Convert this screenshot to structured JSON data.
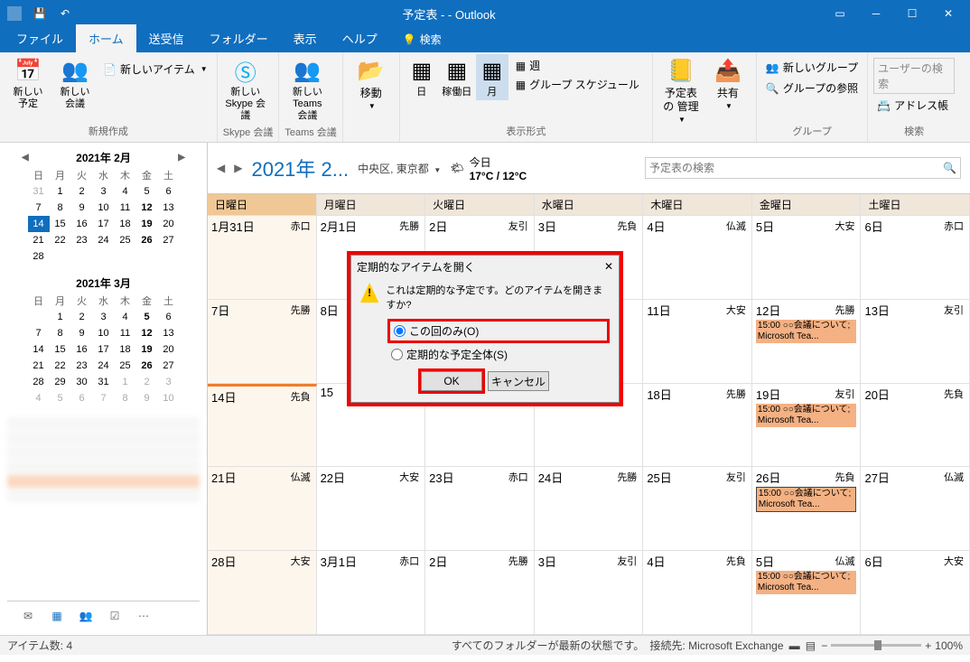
{
  "title": "予定表 -                      - Outlook",
  "tabs": {
    "file": "ファイル",
    "home": "ホーム",
    "send": "送受信",
    "folder": "フォルダー",
    "view": "表示",
    "help": "ヘルプ",
    "search": "検索"
  },
  "ribbon": {
    "newAppt": "新しい\n予定",
    "newMeeting": "新しい\n会議",
    "newItem": "新しいアイテム",
    "grpNew": "新規作成",
    "skype": "新しい\nSkype 会議",
    "grpSkype": "Skype 会議",
    "teams": "新しい\nTeams 会議",
    "grpTeams": "Teams 会議",
    "move": "移動",
    "day": "日",
    "workweek": "稼働日",
    "month": "月",
    "week": "週",
    "groupSched": "グループ スケジュール",
    "grpView": "表示形式",
    "manageCal": "予定表の\n管理",
    "share": "共有",
    "newGroup": "新しいグループ",
    "browseGroup": "グループの参照",
    "grpGroup": "グループ",
    "findUser": "ユーザーの検索",
    "addressBook": "アドレス帳",
    "grpFind": "検索"
  },
  "miniCal1": {
    "title": "2021年 2月",
    "dow": [
      "日",
      "月",
      "火",
      "水",
      "木",
      "金",
      "土"
    ],
    "days": [
      [
        "31",
        "1",
        "2",
        "3",
        "4",
        "5",
        "6"
      ],
      [
        "7",
        "8",
        "9",
        "10",
        "11",
        "12",
        "13"
      ],
      [
        "14",
        "15",
        "16",
        "17",
        "18",
        "19",
        "20"
      ],
      [
        "21",
        "22",
        "23",
        "24",
        "25",
        "26",
        "27"
      ],
      [
        "28",
        "",
        "",
        "",
        "",
        "",
        ""
      ]
    ],
    "today": 14,
    "bold": [
      12,
      19,
      26
    ]
  },
  "miniCal2": {
    "title": "2021年 3月",
    "dow": [
      "日",
      "月",
      "火",
      "水",
      "木",
      "金",
      "土"
    ],
    "days": [
      [
        "",
        "1",
        "2",
        "3",
        "4",
        "5",
        "6"
      ],
      [
        "7",
        "8",
        "9",
        "10",
        "11",
        "12",
        "13"
      ],
      [
        "14",
        "15",
        "16",
        "17",
        "18",
        "19",
        "20"
      ],
      [
        "21",
        "22",
        "23",
        "24",
        "25",
        "26",
        "27"
      ],
      [
        "28",
        "29",
        "30",
        "31",
        "1",
        "2",
        "3"
      ],
      [
        "4",
        "5",
        "6",
        "7",
        "8",
        "9",
        "10"
      ]
    ],
    "bold": [
      5,
      12,
      19,
      26
    ]
  },
  "calHeader": {
    "title": "2021年 2...",
    "location": "中央区, 東京都",
    "todayLabel": "今日",
    "temp": "17°C / 12°C",
    "searchPlaceholder": "予定表の検索"
  },
  "dow": [
    "日曜日",
    "月曜日",
    "火曜日",
    "水曜日",
    "木曜日",
    "金曜日",
    "土曜日"
  ],
  "weeks": [
    [
      {
        "d": "1月31日",
        "r": "赤口"
      },
      {
        "d": "2月1日",
        "r": "先勝"
      },
      {
        "d": "2日",
        "r": "友引"
      },
      {
        "d": "3日",
        "r": "先負"
      },
      {
        "d": "4日",
        "r": "仏滅"
      },
      {
        "d": "5日",
        "r": "大安"
      },
      {
        "d": "6日",
        "r": "赤口"
      }
    ],
    [
      {
        "d": "7日",
        "r": "先勝"
      },
      {
        "d": "8日",
        "r": ""
      },
      {
        "d": "",
        "r": ""
      },
      {
        "d": "",
        "r": ""
      },
      {
        "d": "11日",
        "r": "大安"
      },
      {
        "d": "12日",
        "r": "先勝",
        "ev": "15:00 ○○会議について; Microsoft Tea..."
      },
      {
        "d": "13日",
        "r": "友引"
      }
    ],
    [
      {
        "d": "14日",
        "r": "先負",
        "hl": true
      },
      {
        "d": "15",
        "r": ""
      },
      {
        "d": "",
        "r": ""
      },
      {
        "d": "",
        "r": ""
      },
      {
        "d": "18日",
        "r": "先勝"
      },
      {
        "d": "19日",
        "r": "友引",
        "ev": "15:00 ○○会議について; Microsoft Tea..."
      },
      {
        "d": "20日",
        "r": "先負"
      }
    ],
    [
      {
        "d": "21日",
        "r": "仏滅"
      },
      {
        "d": "22日",
        "r": "大安"
      },
      {
        "d": "23日",
        "r": "赤口"
      },
      {
        "d": "24日",
        "r": "先勝"
      },
      {
        "d": "25日",
        "r": "友引"
      },
      {
        "d": "26日",
        "r": "先負",
        "ev": "15:00 ○○会議について; Microsoft Tea...",
        "evb": true
      },
      {
        "d": "27日",
        "r": "仏滅"
      }
    ],
    [
      {
        "d": "28日",
        "r": "大安"
      },
      {
        "d": "3月1日",
        "r": "赤口"
      },
      {
        "d": "2日",
        "r": "先勝"
      },
      {
        "d": "3日",
        "r": "友引"
      },
      {
        "d": "4日",
        "r": "先負"
      },
      {
        "d": "5日",
        "r": "仏滅",
        "ev": "15:00 ○○会議について; Microsoft Tea..."
      },
      {
        "d": "6日",
        "r": "大安"
      }
    ]
  ],
  "dialog": {
    "title": "定期的なアイテムを開く",
    "msg": "これは定期的な予定です。どのアイテムを開きますか?",
    "opt1": "この回のみ(O)",
    "opt2": "定期的な予定全体(S)",
    "ok": "OK",
    "cancel": "キャンセル"
  },
  "status": {
    "items": "アイテム数: 4",
    "sync": "すべてのフォルダーが最新の状態です。",
    "conn": "接続先: Microsoft Exchange",
    "zoom": "100%"
  }
}
